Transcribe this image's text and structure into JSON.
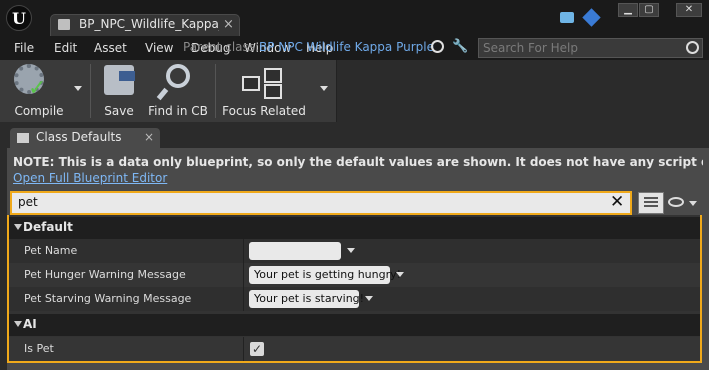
{
  "window": {
    "tab_title": "BP_NPC_Wildlife_Kappa_K",
    "tab_close": "×"
  },
  "menu": {
    "items": [
      "File",
      "Edit",
      "Asset",
      "View",
      "Debug",
      "Window",
      "Help"
    ],
    "parent_class": "Parent class:",
    "blueprint_name": "BP NPC Wildlife Kappa Purple",
    "search_placeholder": "Search For Help"
  },
  "toolbar": {
    "compile": "Compile",
    "save": "Save",
    "find_in_cb": "Find in CB",
    "focus_related": "Focus Related"
  },
  "panel": {
    "tab_label": "Class Defaults",
    "tab_close": "×",
    "note": "NOTE: This is a data only blueprint, so only the default values are shown.  It does not have any script or variables.  If you want to",
    "open_full_link": "Open Full Blueprint Editor",
    "filter_value": "pet",
    "filter_clear": "✕"
  },
  "categories": [
    {
      "label": "Default",
      "properties": [
        {
          "name": "Pet Name",
          "value": ""
        },
        {
          "name": "Pet Hunger Warning Message",
          "value": "Your pet is getting hungry!"
        },
        {
          "name": "Pet Starving Warning Message",
          "value": "Your pet is starving!"
        }
      ]
    },
    {
      "label": "AI",
      "properties": [
        {
          "name": "Is Pet",
          "checked": true
        }
      ]
    }
  ],
  "colors": {
    "accent_orange": "#f0a91a",
    "link_blue": "#7fb8f5",
    "blueprint_name_blue": "#6fa9e8"
  },
  "icons": {
    "logo": "unreal-logo-icon",
    "compile": "gear-check-icon",
    "save": "floppy-disk-icon",
    "find": "magnifier-icon",
    "focus": "nodes-icon",
    "visibility": "eye-icon"
  }
}
